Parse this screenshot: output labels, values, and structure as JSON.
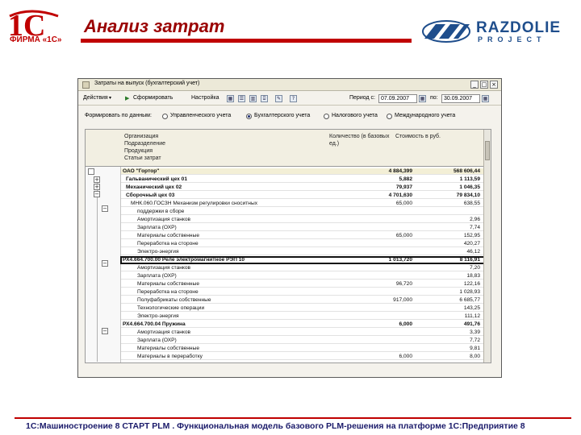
{
  "slide": {
    "title": "Анализ затрат",
    "logo_1c_text": "1С",
    "logo_1c_sub": "ФИРМА «1С»",
    "logo_razdolie_word": "RAZDOLIE",
    "logo_razdolie_sub": "PROJECT",
    "footer": "1С:Машиностроение 8 СТАРТ PLM . Функциональная модель базового PLM-решения на платформе 1С:Предприятие 8"
  },
  "window": {
    "title": "Затраты на выпуск (бухгалтерский учет)",
    "btn_minimize": "_",
    "btn_maximize": "□",
    "btn_close": "×"
  },
  "toolbar": {
    "actions": "Действия",
    "actions_arrow": "▾",
    "generate_icon": "▶",
    "generate": "Сформировать",
    "settings": "Настройка",
    "icons": [
      "▦",
      "☰",
      "▥",
      "⌸",
      "✎",
      "?"
    ],
    "period_from_label": "Период с:",
    "period_from": "07.09.2007",
    "period_to_label": "по:",
    "period_to": "30.09.2007",
    "calendar_icons": [
      "▦",
      "▦"
    ]
  },
  "form_by": {
    "label": "Формировать по данным:",
    "options": [
      {
        "label": "Управленческого учета",
        "selected": false
      },
      {
        "label": "Бухгалтерского учета",
        "selected": true
      },
      {
        "label": "Налогового учета",
        "selected": false
      },
      {
        "label": "Международного учета",
        "selected": false
      }
    ]
  },
  "grid": {
    "header_lines": [
      "Организация",
      "Подразделение",
      "Продукция",
      "Статьи затрат"
    ],
    "col_qty": "Количество (в базовых ед.)",
    "col_cost": "Стоимость в руб.",
    "rows": [
      {
        "name": "ОАО \"Гортор\"",
        "qty": "4 884,399",
        "cost": "568 606,44",
        "bold": true,
        "total": true
      },
      {
        "name": "Гальванический цех 01",
        "qty": "5,882",
        "cost": "1 113,59",
        "bold": true
      },
      {
        "name": "Механический цех 02",
        "qty": "79,937",
        "cost": "1 046,35",
        "bold": true
      },
      {
        "name": "Сборочный цех 03",
        "qty": "4 701,630",
        "cost": "79 834,10",
        "bold": true
      },
      {
        "name": "МНК.060.ГОСЗН Механизм регулировки сноситных",
        "qty": "65,000",
        "cost": "638,55",
        "bold": false
      },
      {
        "name": "поддержки в сборе",
        "qty": "",
        "cost": "",
        "bold": false
      },
      {
        "name": "Амортизация станков",
        "qty": "",
        "cost": "2,96",
        "bold": false
      },
      {
        "name": "Зарплата (ОХР)",
        "qty": "",
        "cost": "7,74",
        "bold": false
      },
      {
        "name": "Материалы собственные",
        "qty": "65,000",
        "cost": "152,95",
        "bold": false
      },
      {
        "name": "Переработка на стороне",
        "qty": "",
        "cost": "420,27",
        "bold": false
      },
      {
        "name": "Электро-энергия",
        "qty": "",
        "cost": "46,12",
        "bold": false
      },
      {
        "name": "РХ4.664.700.00 Реле электромагнитное РЭП 10",
        "qty": "1 013,720",
        "cost": "8 116,91",
        "bold": true,
        "selected": true
      },
      {
        "name": "Амортизация станков",
        "qty": "",
        "cost": "7,20",
        "bold": false
      },
      {
        "name": "Зарплата (ОХР)",
        "qty": "",
        "cost": "18,83",
        "bold": false
      },
      {
        "name": "Материалы собственные",
        "qty": "96,720",
        "cost": "122,16",
        "bold": false
      },
      {
        "name": "Переработка на стороне",
        "qty": "",
        "cost": "1 028,93",
        "bold": false
      },
      {
        "name": "Полуфабрикаты собственные",
        "qty": "917,000",
        "cost": "6 685,77",
        "bold": false
      },
      {
        "name": "Технологические операции",
        "qty": "",
        "cost": "143,25",
        "bold": false
      },
      {
        "name": "Электро-энергия",
        "qty": "",
        "cost": "111,12",
        "bold": false
      },
      {
        "name": "РХ4.664.700.04 Пружина",
        "qty": "6,000",
        "cost": "491,76",
        "bold": true
      },
      {
        "name": "Амортизация станков",
        "qty": "",
        "cost": "3,39",
        "bold": false
      },
      {
        "name": "Зарплата (ОХР)",
        "qty": "",
        "cost": "7,72",
        "bold": false
      },
      {
        "name": "Материалы собственные",
        "qty": "",
        "cost": "9,81",
        "bold": false
      },
      {
        "name": "Материалы в переработку",
        "qty": "6,000",
        "cost": "8,00",
        "bold": false
      }
    ]
  },
  "colors": {
    "brand_red": "#c00000",
    "title_red": "#9a0000",
    "razdolie_blue": "#1f4e8c",
    "footer_text": "#1a1a6a"
  }
}
